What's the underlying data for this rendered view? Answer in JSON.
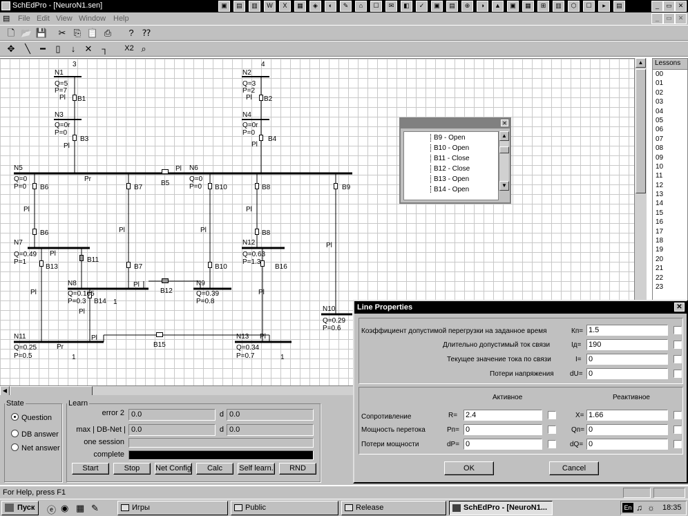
{
  "window": {
    "title": "SchEdPro - [NeuroN1.sen]"
  },
  "menu": [
    "File",
    "Edit",
    "View",
    "Window",
    "Help"
  ],
  "toolbar2": {
    "zoom_label": "X2"
  },
  "diagram": {
    "nodes": [
      {
        "name": "N1",
        "q": "Q=5",
        "p": "P=7"
      },
      {
        "name": "N2",
        "q": "Q=3",
        "p": "P=2"
      },
      {
        "name": "N3",
        "q": "Q=0r",
        "p": "P=0"
      },
      {
        "name": "N4",
        "q": "Q=0r",
        "p": "P=0"
      },
      {
        "name": "N5",
        "q": "Q=0",
        "p": "P=0"
      },
      {
        "name": "N6",
        "q": "Q=0",
        "p": "P=0"
      },
      {
        "name": "N7",
        "q": "Q=0.49",
        "p": "P=1"
      },
      {
        "name": "N8",
        "q": "Q=0.165",
        "p": "P=0.3"
      },
      {
        "name": "N9",
        "q": "Q=0.39",
        "p": "P=0.8"
      },
      {
        "name": "N10",
        "q": "Q=0.29",
        "p": "P=0.6"
      },
      {
        "name": "N11",
        "q": "Q=0.25",
        "p": "P=0.5"
      },
      {
        "name": "N12",
        "q": "Q=0.63",
        "p": "P=1.3"
      },
      {
        "name": "N13",
        "q": "Q=0.34",
        "p": "P=0.7"
      }
    ],
    "branches": [
      "B1",
      "B2",
      "B3",
      "B4",
      "B5",
      "B6",
      "B7",
      "B8",
      "B9",
      "B10",
      "B11",
      "B12",
      "B13",
      "B14",
      "B15",
      "B16"
    ],
    "line_mark": "Pl",
    "gen_mark": "Pr",
    "numbers": [
      "3",
      "4",
      "1"
    ]
  },
  "branch_list": [
    "B9 - Open",
    "B10 - Open",
    "B11 - Close",
    "B12 - Close",
    "B13 - Open",
    "B14 - Open"
  ],
  "lessons": {
    "header": "Lessons",
    "items": [
      "00",
      "01",
      "02",
      "03",
      "04",
      "05",
      "06",
      "07",
      "08",
      "09",
      "10",
      "11",
      "12",
      "13",
      "14",
      "15",
      "16",
      "17",
      "18",
      "19",
      "20",
      "21",
      "22",
      "23"
    ]
  },
  "state": {
    "title": "State",
    "options": [
      "Question",
      "DB answer",
      "Net answer"
    ],
    "selected": 0
  },
  "learn": {
    "title": "Learn",
    "error_label": "error 2",
    "error_value": "0.0",
    "error_d": "0.0",
    "maxdb_label": "max | DB-Net |",
    "maxdb_value": "0.0",
    "maxdb_d": "0.0",
    "d_label": "d",
    "session_label": "one session",
    "complete_label": "complete",
    "complete_fraction": 1.0,
    "buttons": [
      "Start",
      "Stop",
      "Net Config",
      "Calc",
      "Self learn.",
      "RND"
    ]
  },
  "dialog": {
    "title": "Line Properties",
    "rows": [
      {
        "label": "Коэффициент допустимой перегрузки на заданное время",
        "code": "Кп=",
        "value": "1.5"
      },
      {
        "label": "Длительно допустимый ток связи",
        "code": "Iд=",
        "value": "190"
      },
      {
        "label": "Текущее значение тока по связи",
        "code": "I=",
        "value": "0"
      },
      {
        "label": "Потери напряжения",
        "code": "dU=",
        "value": "0"
      }
    ],
    "col_active": "Активное",
    "col_reactive": "Реактивное",
    "grid": [
      {
        "label": "Сопротивление",
        "a_code": "R=",
        "a_value": "2.4",
        "r_code": "X=",
        "r_value": "1.66"
      },
      {
        "label": "Мощность перетока",
        "a_code": "Pп=",
        "a_value": "0",
        "r_code": "Qп=",
        "r_value": "0"
      },
      {
        "label": "Потери мощности",
        "a_code": "dP=",
        "a_value": "0",
        "r_code": "dQ=",
        "r_value": "0"
      }
    ],
    "ok": "OK",
    "cancel": "Cancel"
  },
  "status": {
    "text": "For Help, press F1"
  },
  "taskbar": {
    "start": "Пуск",
    "tasks": [
      "Игры",
      "Public",
      "Release",
      "SchEdPro - [NeuroN1..."
    ],
    "clock": "18:35"
  }
}
